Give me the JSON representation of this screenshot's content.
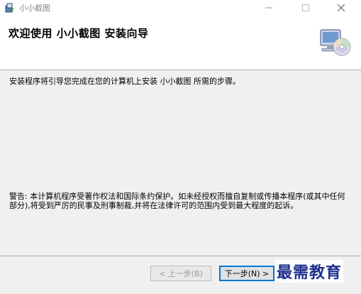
{
  "window": {
    "title": "小小截图"
  },
  "header": {
    "title": "欢迎使用  小小截图  安装向导"
  },
  "body": {
    "intro": "安装程序将引导您完成在您的计算机上安装 小小截图 所需的步骤。",
    "warning": "警告: 本计算机程序受著作权法和国际条约保护。如未经授权而擅自复制或传播本程序(或其中任何部分),将受到严厉的民事及刑事制裁,并将在法律许可的范围内受到最大程度的起诉。"
  },
  "buttons": {
    "back_label": "< 上一步(B)",
    "next_label": "下一步(N) >"
  },
  "watermark": {
    "text": "最需教育"
  },
  "colors": {
    "accent": "#0078d7",
    "watermark": "#1f2f8f"
  }
}
